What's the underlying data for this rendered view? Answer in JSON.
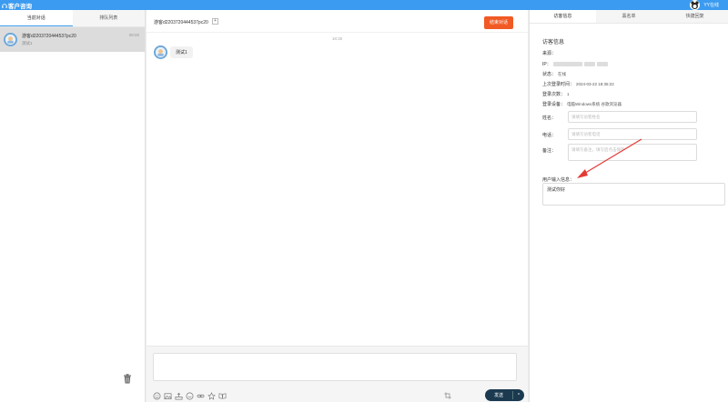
{
  "app": {
    "title": "客户咨询",
    "username": "YY在线"
  },
  "left": {
    "tabs": [
      "当前对话",
      "排队列表"
    ],
    "session": {
      "name": "游客d2203720444537pc20",
      "message": "测试1",
      "time": "08:00"
    }
  },
  "middle": {
    "header_title": "游客d2203720444537pc20",
    "header_small_button": "+",
    "end_button": "结束对话",
    "chat_time": "18:35",
    "message": "测试1",
    "send_label": "发送",
    "send_arrow": "^"
  },
  "right": {
    "tabs": [
      "访客信息",
      "黑名单",
      "快捷回复"
    ],
    "section_title": "访客信息",
    "source_label": "来源：",
    "ip_label": "IP：",
    "status_label": "状态：",
    "status_value": "在线",
    "last_login_label": "上次登录时间：",
    "last_login_value": "2024-03-22 18:35:22",
    "login_count_label": "登录次数：",
    "login_count_value": "1",
    "device_label": "登录设备：",
    "device_value": "电脑Windows系统 谷歌浏览器",
    "name_label": "姓名：",
    "name_placeholder": "请填写访客姓名",
    "phone_label": "电话：",
    "phone_placeholder": "请填写访客电话",
    "remark_label": "备注：",
    "remark_placeholder": "请填写备注，填写后点击保存",
    "user_input_label": "用户输入信息：",
    "user_input_value": "测试你好"
  },
  "colors": {
    "topbar": "#3b9bf0",
    "end_button": "#f15a24",
    "send_button": "#1b3a50",
    "arrow": "#e53935"
  }
}
